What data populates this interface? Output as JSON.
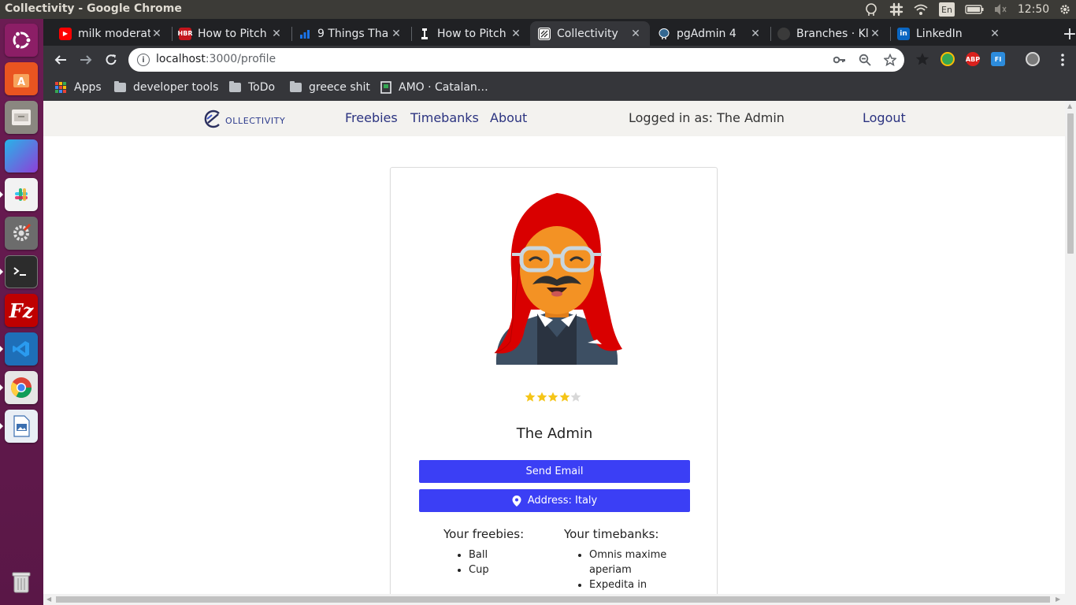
{
  "os": {
    "window_title": "Collectivity - Google Chrome",
    "keyboard_layout": "En",
    "clock": "12:50",
    "launcher_icons": [
      "ubuntu-icon",
      "software-center-icon",
      "files-icon",
      "workspace-icon",
      "slack-icon",
      "settings-icon",
      "terminal-icon",
      "filezilla-icon",
      "vscode-icon",
      "chrome-icon",
      "libreoffice-impress-icon",
      "trash-icon"
    ]
  },
  "browser": {
    "tabs": [
      {
        "title": "milk moderat",
        "favicon": "youtube-icon",
        "color": "#ff0000"
      },
      {
        "title": "How to Pitch",
        "favicon": "hbr-icon",
        "color": "#c4161c"
      },
      {
        "title": "9 Things Tha",
        "favicon": "bar-chart-icon",
        "color": "#1a73e8"
      },
      {
        "title": "How to Pitch",
        "favicon": "medium-icon",
        "color": "#000000"
      },
      {
        "title": "Collectivity",
        "favicon": "collectivity-icon",
        "color": "#ffffff"
      },
      {
        "title": "pgAdmin 4",
        "favicon": "elephant-icon",
        "color": "#336791"
      },
      {
        "title": "Branches · Kl",
        "favicon": "github-icon",
        "color": "#24292e"
      },
      {
        "title": "LinkedIn",
        "favicon": "linkedin-icon",
        "color": "#0a66c2"
      }
    ],
    "active_tab_index": 4,
    "url_host": "localhost",
    "url_rest": ":3000/profile",
    "bookmarks": [
      {
        "label": "Apps",
        "icon": "apps-grid-icon"
      },
      {
        "label": "developer tools",
        "icon": "folder-icon"
      },
      {
        "label": "ToDo",
        "icon": "folder-icon"
      },
      {
        "label": "greece shit",
        "icon": "folder-icon"
      },
      {
        "label": "AMO · Catalan…",
        "icon": "document-icon"
      }
    ]
  },
  "app": {
    "logo_text": "OLLECTIVITY",
    "nav": {
      "freebies": "Freebies",
      "timebanks": "Timebanks",
      "about": "About",
      "logged_in_label": "Logged in as:  The Admin",
      "logout": "Logout"
    },
    "profile": {
      "rating": 4,
      "rating_max": 5,
      "name": "The Admin",
      "send_email_label": "Send Email",
      "address_label": "Address: Italy",
      "freebies_heading": "Your freebies:",
      "freebies": [
        "Ball",
        "Cup"
      ],
      "timebanks_heading": "Your timebanks:",
      "timebanks": [
        "Omnis maxime aperiam",
        "Expedita in"
      ]
    },
    "colors": {
      "primary_button": "#3b3ff5",
      "nav_link": "#2b3380",
      "star_filled": "#f5c518",
      "star_empty": "#d8d8d8",
      "hair": "#d90000"
    }
  }
}
